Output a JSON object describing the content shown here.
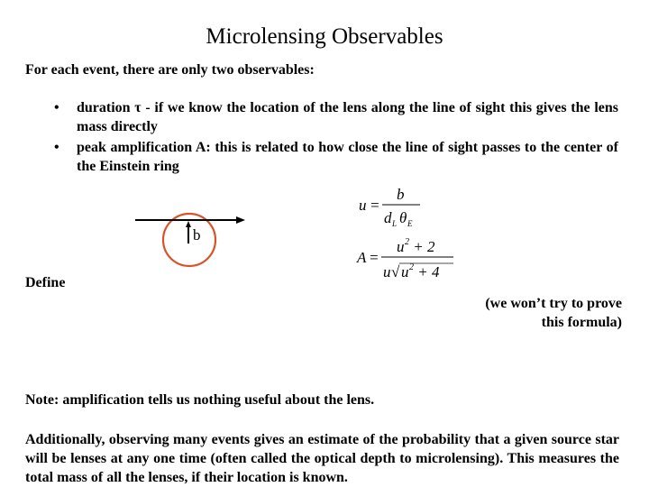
{
  "slide": {
    "title": "Microlensing Observables",
    "intro": "For each event, there are only two observables:",
    "bullets": [
      {
        "marker": "•",
        "text": "duration τ - if we know the location of the lens along the line of sight this gives the lens mass directly"
      },
      {
        "marker": "•",
        "text": "peak amplification A: this is related to how close the line of sight passes to the center of the Einstein ring"
      }
    ],
    "diagram": {
      "impact_label": "b",
      "ring_color": "#d9532a",
      "line_color": "#000000"
    },
    "formulas": {
      "u": {
        "lhs": "u",
        "equals": "=",
        "numerator": "b",
        "denominator_d": "d",
        "denominator_d_sub": "L",
        "denominator_theta": "θ",
        "denominator_theta_sub": "E"
      },
      "A": {
        "lhs": "A",
        "equals": "=",
        "num_base": "u",
        "num_exp": "2",
        "num_rest": " + 2",
        "den_u": "u",
        "den_sqrt": "√",
        "den_base": "u",
        "den_exp": "2",
        "den_rest": " + 4"
      }
    },
    "define_label": "Define",
    "aside": "(we won’t try to prove this formula)",
    "note": "Note: amplification tells us nothing useful about the lens.",
    "paragraph": "Additionally, observing many events gives an estimate of the probability that a given source star will be lenses at any one time (often called the optical depth to microlensing). This measures the total mass of all the lenses, if their location is known."
  }
}
